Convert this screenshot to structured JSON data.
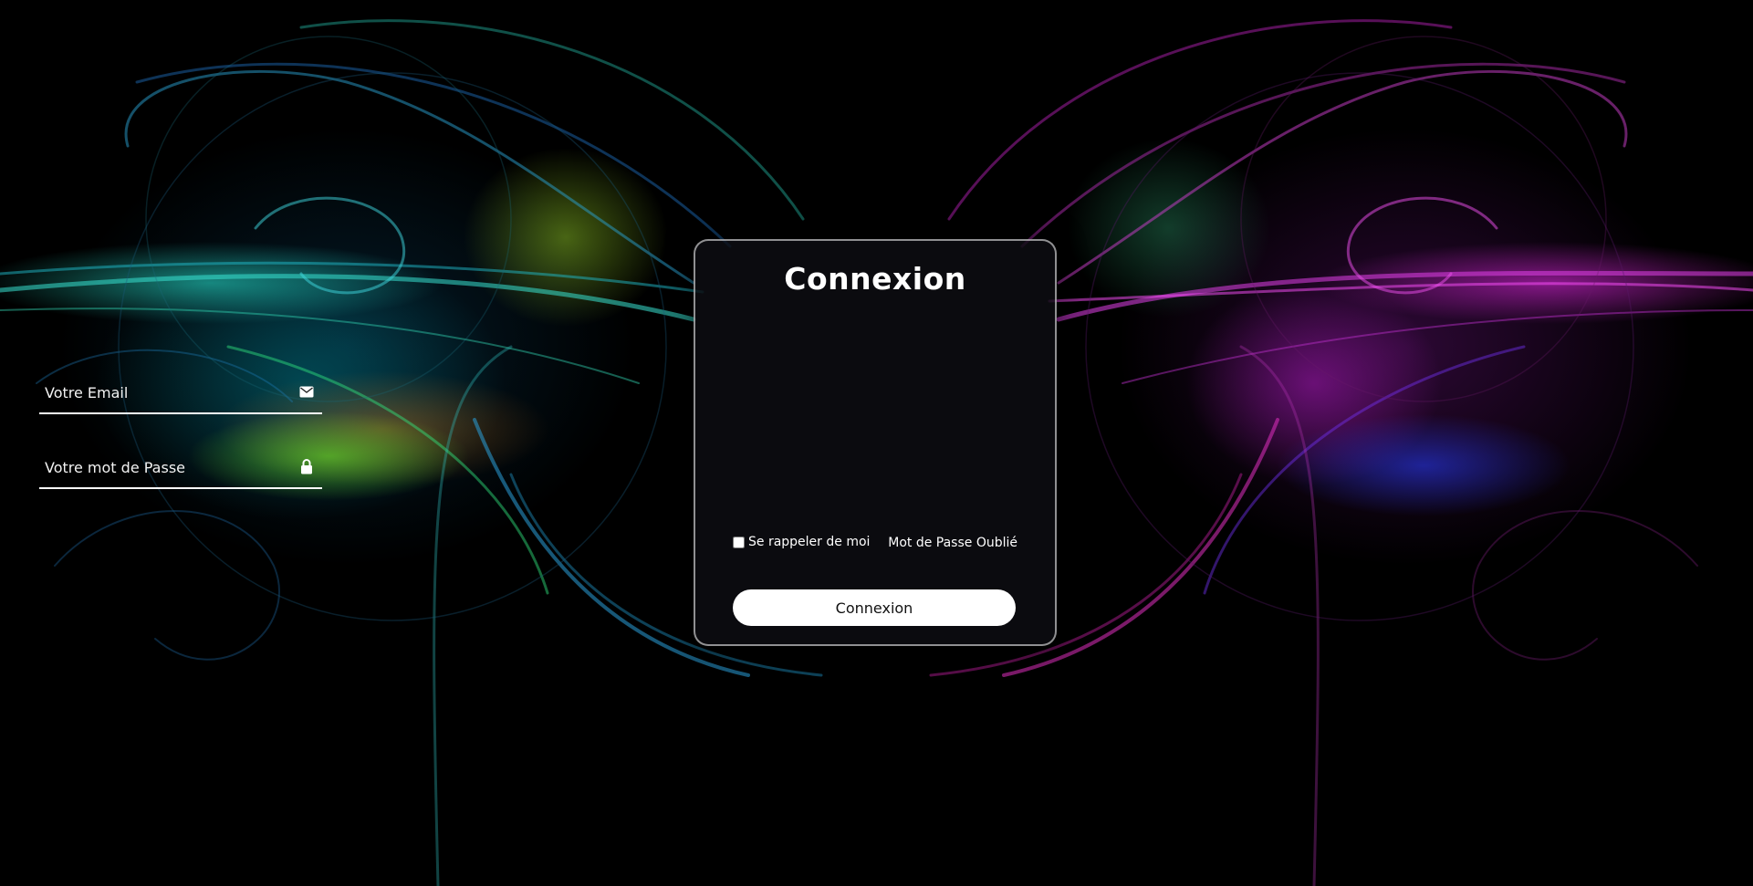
{
  "login": {
    "title": "Connexion",
    "email_placeholder": "Votre Email",
    "password_placeholder": "Votre mot de Passe",
    "remember_label": "Se rappeler de moi",
    "forgot_label": "Mot de Passe Oublié",
    "submit_label": "Connexion"
  },
  "icons": {
    "email": "envelope-icon",
    "password": "lock-icon"
  },
  "colors": {
    "background": "#000000",
    "card_border": "#ffffff",
    "button_bg": "#ffffff",
    "button_text": "#111111",
    "accent_left": "#20e0c8",
    "accent_right": "#e030e0"
  }
}
